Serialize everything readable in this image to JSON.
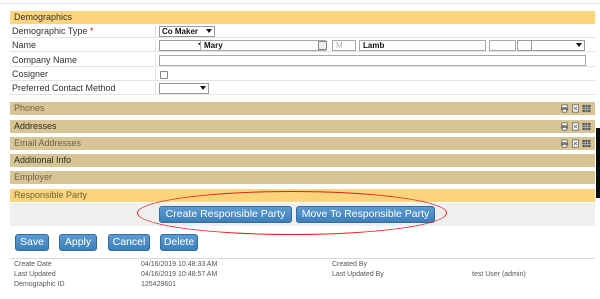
{
  "demographics": {
    "header": "Demographics",
    "type_label": "Demographic Type",
    "type_required": "*",
    "type_value": "Co Maker",
    "name_label": "Name",
    "first_name": "Mary",
    "middle_placeholder": "M",
    "last_name": "Lamb",
    "company_label": "Company Name",
    "cosigner_label": "Cosigner",
    "contact_label": "Preferred Contact Method"
  },
  "sections": {
    "phones": "Phones",
    "addresses": "Addresses",
    "email": "Email Addresses",
    "additional": "Additional Info",
    "employer": "Employer",
    "responsible": "Responsible Party"
  },
  "responsible_party": {
    "create_label": "Create Responsible Party",
    "move_label": "Move To Responsible Party"
  },
  "actions": {
    "save": "Save",
    "apply": "Apply",
    "cancel": "Cancel",
    "delete": "Delete"
  },
  "meta": {
    "create_date_label": "Create Date",
    "create_date": "04/16/2019 10:48:33 AM",
    "created_by_label": "Created By",
    "created_by": "",
    "last_updated_label": "Last Updated",
    "last_updated": "04/16/2019 10:48:57 AM",
    "last_updated_by_label": "Last Updated By",
    "last_updated_by": "test User (admin)",
    "demographic_id_label": "Demographic ID",
    "demographic_id": "125429601"
  },
  "colors": {
    "header_yellow": "#fbd47b",
    "section_tan": "#d8c596",
    "button_blue": "#4a8ac4",
    "highlight_red": "#e02020"
  }
}
